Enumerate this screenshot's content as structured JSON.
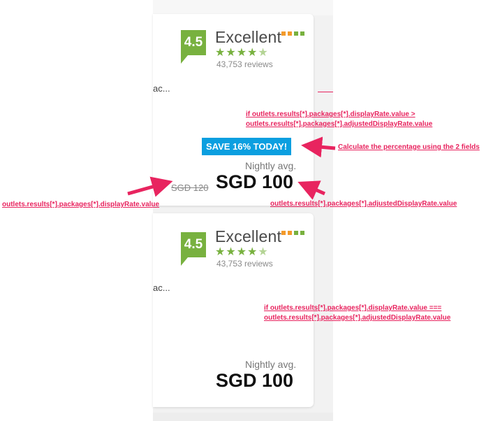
{
  "card1": {
    "score": "4.5",
    "rating_label": "Excellent",
    "reviews": "43,753 reviews",
    "truncated": "ac...",
    "save_badge": "SAVE 16% TODAY!",
    "nightly_label": "Nightly avg.",
    "old_price": "SGD 120",
    "price": "SGD 100"
  },
  "card2": {
    "score": "4.5",
    "rating_label": "Excellent",
    "reviews": "43,753 reviews",
    "truncated": "ac...",
    "nightly_label": "Nightly avg.",
    "price": "SGD 100"
  },
  "annotations": {
    "cond_gt_line1": "if outlets.results[*].packages[*].displayRate.value >",
    "cond_gt_line2": "outlets.results[*].packages[*].adjustedDisplayRate.value",
    "calc_percentage": "Calculate the percentage using the 2 fields",
    "display_rate": "outlets.results[*].packages[*].displayRate.value",
    "adjusted_rate": "outlets.results[*].packages[*].adjustedDisplayRate.value",
    "cond_eq_line1": "if outlets.results[*].packages[*].displayRate.value ===",
    "cond_eq_line2": "outlets.results[*].packages[*].adjustedDisplayRate.value"
  },
  "colors": {
    "score_green": "#78b13f",
    "save_blue": "#0b9fe0",
    "annotation_pink": "#e8245f",
    "bar_orange": "#f39a2b",
    "bar_green": "#78b13f"
  }
}
